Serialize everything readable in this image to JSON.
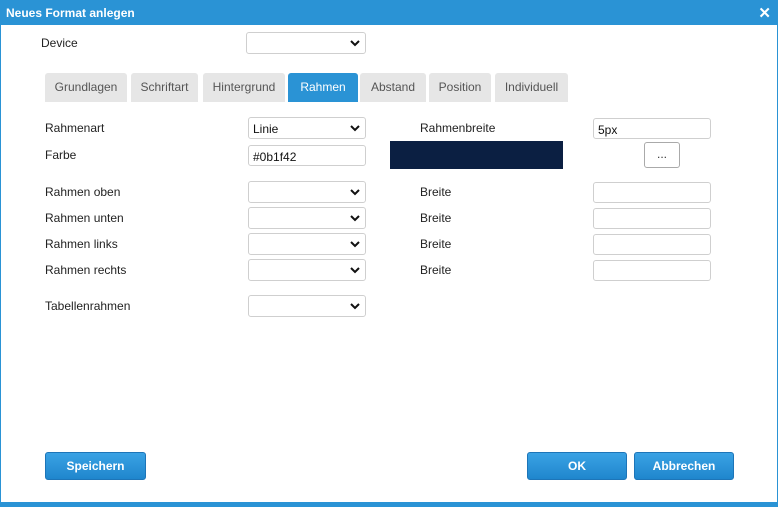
{
  "dialog": {
    "title": "Neues Format anlegen",
    "close_glyph": "✕"
  },
  "device": {
    "label": "Device",
    "value": ""
  },
  "tabs": [
    {
      "label": "Grundlagen"
    },
    {
      "label": "Schriftart"
    },
    {
      "label": "Hintergrund"
    },
    {
      "label": "Rahmen",
      "active": true
    },
    {
      "label": "Abstand"
    },
    {
      "label": "Position"
    },
    {
      "label": "Individuell"
    }
  ],
  "form": {
    "rahmenart": {
      "label": "Rahmenart",
      "value": "Linie"
    },
    "rahmenbreite": {
      "label": "Rahmenbreite",
      "value": "5px"
    },
    "farbe": {
      "label": "Farbe",
      "value": "#0b1f42",
      "swatch_color": "#0b1f42",
      "picker_label": "..."
    },
    "rows": [
      {
        "label": "Rahmen oben",
        "value": "",
        "width_label": "Breite",
        "width_value": ""
      },
      {
        "label": "Rahmen unten",
        "value": "",
        "width_label": "Breite",
        "width_value": ""
      },
      {
        "label": "Rahmen links",
        "value": "",
        "width_label": "Breite",
        "width_value": ""
      },
      {
        "label": "Rahmen rechts",
        "value": "",
        "width_label": "Breite",
        "width_value": ""
      }
    ],
    "tabellenrahmen": {
      "label": "Tabellenrahmen",
      "value": ""
    }
  },
  "buttons": {
    "save": "Speichern",
    "ok": "OK",
    "cancel": "Abbrechen"
  },
  "colors": {
    "accent": "#2a93d5",
    "swatch": "#0b1f42"
  }
}
